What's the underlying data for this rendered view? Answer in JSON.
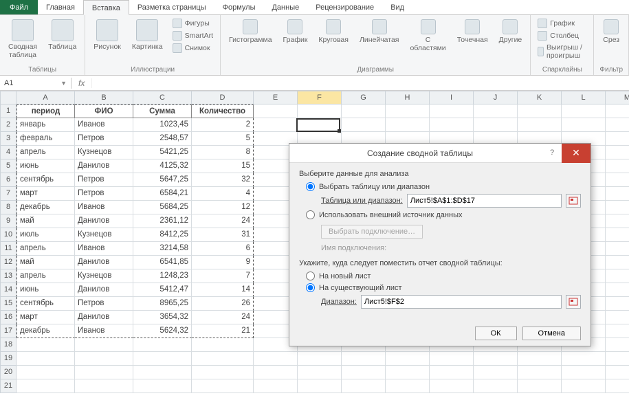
{
  "ribbon": {
    "file": "Файл",
    "tabs": [
      "Главная",
      "Вставка",
      "Разметка страницы",
      "Формулы",
      "Данные",
      "Рецензирование",
      "Вид"
    ],
    "active_tab_index": 1,
    "groups": {
      "tables": {
        "label": "Таблицы",
        "pivot": "Сводная\nтаблица",
        "table": "Таблица"
      },
      "illustrations": {
        "label": "Иллюстрации",
        "picture": "Рисунок",
        "clipart": "Картинка",
        "shapes": "Фигуры",
        "smartart": "SmartArt",
        "screenshot": "Снимок"
      },
      "charts": {
        "label": "Диаграммы",
        "column": "Гистограмма",
        "line": "График",
        "pie": "Круговая",
        "bar": "Линейчатая",
        "area": "С\nобластями",
        "scatter": "Точечная",
        "other": "Другие"
      },
      "sparklines": {
        "label": "Спарклайны",
        "line": "График",
        "column": "Столбец",
        "winloss": "Выигрыш / проигрыш"
      },
      "filter": {
        "label": "Фильтр",
        "slicer": "Срез"
      }
    }
  },
  "namebox": {
    "value": "A1",
    "fx": "fx"
  },
  "columns": [
    "A",
    "B",
    "C",
    "D",
    "E",
    "F",
    "G",
    "H",
    "I",
    "J",
    "K",
    "L",
    "M"
  ],
  "rows": [
    1,
    2,
    3,
    4,
    5,
    6,
    7,
    8,
    9,
    10,
    11,
    12,
    13,
    14,
    15,
    16,
    17,
    18,
    19,
    20,
    21
  ],
  "headers": [
    "период",
    "ФИО",
    "Сумма",
    "Количество"
  ],
  "data": [
    [
      "январь",
      "Иванов",
      "1023,45",
      "2"
    ],
    [
      "февраль",
      "Петров",
      "2548,57",
      "5"
    ],
    [
      "апрель",
      "Кузнецов",
      "5421,25",
      "8"
    ],
    [
      "июнь",
      "Данилов",
      "4125,32",
      "15"
    ],
    [
      "сентябрь",
      "Петров",
      "5647,25",
      "32"
    ],
    [
      "март",
      "Петров",
      "6584,21",
      "4"
    ],
    [
      "декабрь",
      "Иванов",
      "5684,25",
      "12"
    ],
    [
      "май",
      "Данилов",
      "2361,12",
      "24"
    ],
    [
      "июль",
      "Кузнецов",
      "8412,25",
      "31"
    ],
    [
      "апрель",
      "Иванов",
      "3214,58",
      "6"
    ],
    [
      "май",
      "Данилов",
      "6541,85",
      "9"
    ],
    [
      "апрель",
      "Кузнецов",
      "1248,23",
      "7"
    ],
    [
      "июнь",
      "Данилов",
      "5412,47",
      "14"
    ],
    [
      "сентябрь",
      "Петров",
      "8965,25",
      "26"
    ],
    [
      "март",
      "Данилов",
      "3654,32",
      "24"
    ],
    [
      "декабрь",
      "Иванов",
      "5624,32",
      "21"
    ]
  ],
  "dialog": {
    "title": "Создание сводной таблицы",
    "section1": "Выберите данные для анализа",
    "opt_select_range": "Выбрать таблицу или диапазон",
    "range_label": "Таблица или диапазон:",
    "range_value": "Лист5!$A$1:$D$17",
    "opt_external": "Использовать внешний источник данных",
    "choose_conn": "Выбрать подключение…",
    "conn_name_label": "Имя подключения:",
    "section2": "Укажите, куда следует поместить отчет сводной таблицы:",
    "opt_new_sheet": "На новый лист",
    "opt_existing": "На существующий лист",
    "dest_label": "Диапазон:",
    "dest_value": "Лист5!$F$2",
    "ok": "ОК",
    "cancel": "Отмена"
  }
}
